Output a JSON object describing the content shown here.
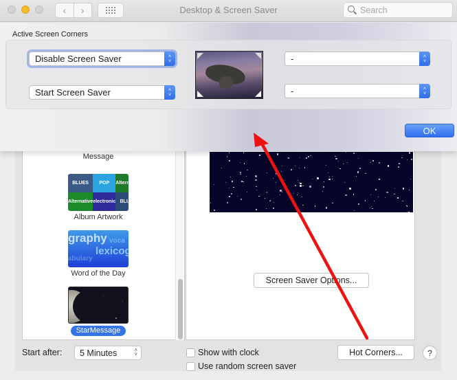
{
  "window": {
    "title": "Desktop & Screen Saver",
    "search_placeholder": "Search"
  },
  "sheet": {
    "title": "Active Screen Corners",
    "corners": {
      "top_left": "Disable Screen Saver",
      "bottom_left": "Start Screen Saver",
      "top_right": "-",
      "bottom_right": "-"
    },
    "ok_label": "OK"
  },
  "screen_savers": [
    {
      "label": "Message"
    },
    {
      "label": "Album Artwork",
      "tiles": [
        "BLUES",
        "POP",
        "Alternative",
        "electronic",
        "Alternative",
        "electronic",
        "BLUES",
        "POP"
      ]
    },
    {
      "label": "Word of the Day",
      "words": [
        "graphy",
        "voca",
        "lexicog",
        "abulary"
      ]
    },
    {
      "label": "StarMessage",
      "selected": true
    }
  ],
  "preview": {
    "options_label": "Screen Saver Options..."
  },
  "footer": {
    "start_after_label": "Start after:",
    "start_after_value": "5 Minutes",
    "show_with_clock_label": "Show with clock",
    "show_with_clock_checked": false,
    "random_label": "Use random screen saver",
    "random_checked": false,
    "hot_corners_label": "Hot Corners...",
    "help_label": "?"
  },
  "annotation": {
    "arrow_color": "#ee1111"
  },
  "colors": {
    "accent": "#2f6ee8",
    "selection": "#3474e6"
  }
}
